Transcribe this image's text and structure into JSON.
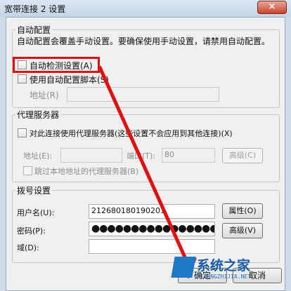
{
  "window": {
    "title": "宽带连接 2 设置",
    "close_glyph": "×"
  },
  "auto_config": {
    "legend": "自动配置",
    "description": "自动配置会覆盖手动设置。要确保使用手动设置，请禁用自动配置。",
    "auto_detect_label": "自动检测设置(A)",
    "auto_detect_checked": false,
    "use_script_label": "使用自动配置脚本(S)",
    "use_script_checked": false,
    "address_label": "地址(R)",
    "address_value": ""
  },
  "proxy": {
    "legend": "代理服务器",
    "use_proxy_label": "对此连接使用代理服务器(这些设置不会应用到其他连接)(X)",
    "use_proxy_checked": false,
    "address_label": "地址(E):",
    "address_value": "",
    "port_label": "端口(T):",
    "port_value": "80",
    "advanced_button": "高级(C)",
    "bypass_label": "跳过本地地址的代理服务器(B)",
    "bypass_checked": false
  },
  "dialup": {
    "legend": "拨号设置",
    "username_label": "用户名(U):",
    "username_value": "212680180190201",
    "password_label": "密码(P):",
    "password_value": "●●●●●●●●●●●●●●●●",
    "domain_label": "域(D):",
    "domain_value": "",
    "properties_button": "属性(O)",
    "advanced_button": "高级(V)"
  },
  "footer": {
    "ok_button": "确定",
    "cancel_button": "取消"
  },
  "watermark": {
    "text": "系统之家",
    "url": "XITONGZHIJIA.NET"
  },
  "colors": {
    "annotation": "#e01010",
    "watermark": "#1b5ba8"
  }
}
